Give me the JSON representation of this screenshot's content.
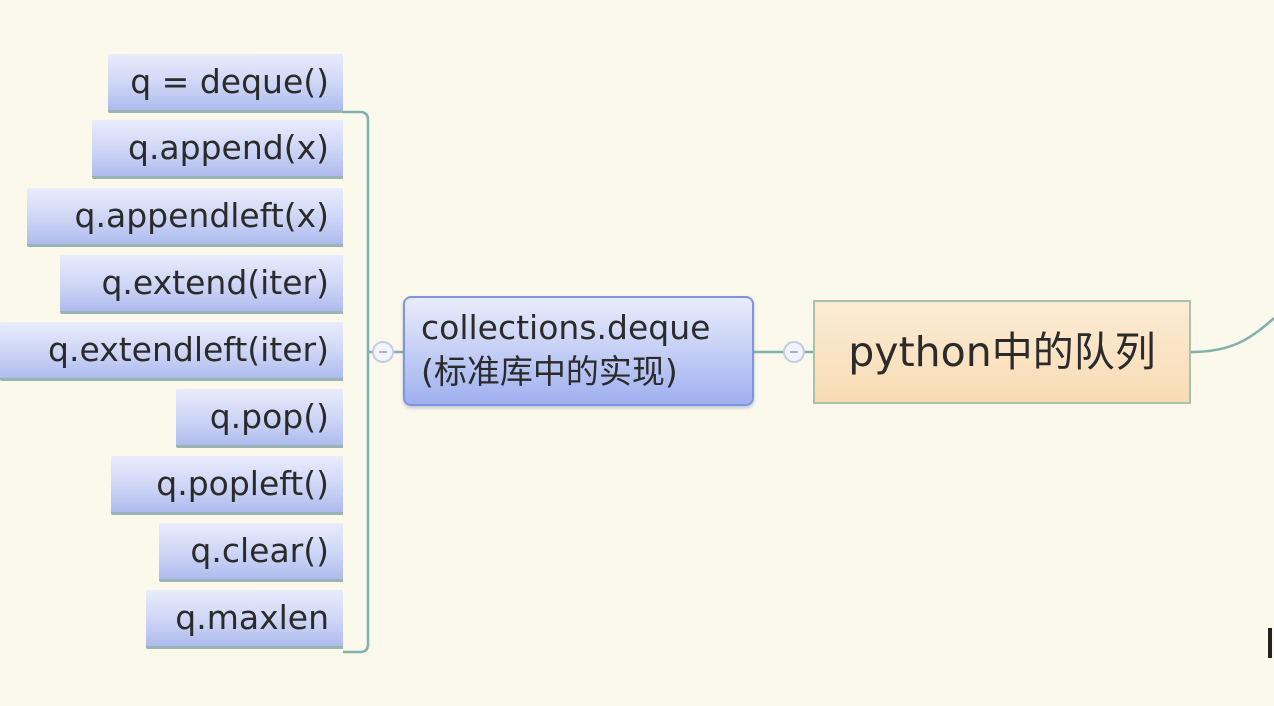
{
  "mindmap": {
    "root": {
      "label": "python中的队列"
    },
    "branch": {
      "line1": "collections.deque",
      "line2": "(标准库中的实现)"
    },
    "leaves": [
      {
        "label": "q = deque()"
      },
      {
        "label": "q.append(x)"
      },
      {
        "label": "q.appendleft(x)"
      },
      {
        "label": "q.extend(iter)"
      },
      {
        "label": "q.extendleft(iter)"
      },
      {
        "label": "q.pop()"
      },
      {
        "label": "q.popleft()"
      },
      {
        "label": "q.clear()"
      },
      {
        "label": "q.maxlen"
      }
    ]
  },
  "colors": {
    "background": "#fbf8ec",
    "connector": "#7fb1ae",
    "leaf_fill": "#cdd5f6",
    "branch_fill": "#c9d2f6",
    "branch_border": "#7f96de",
    "root_fill": "#f8dcb5",
    "root_border": "#a9c2a9"
  }
}
